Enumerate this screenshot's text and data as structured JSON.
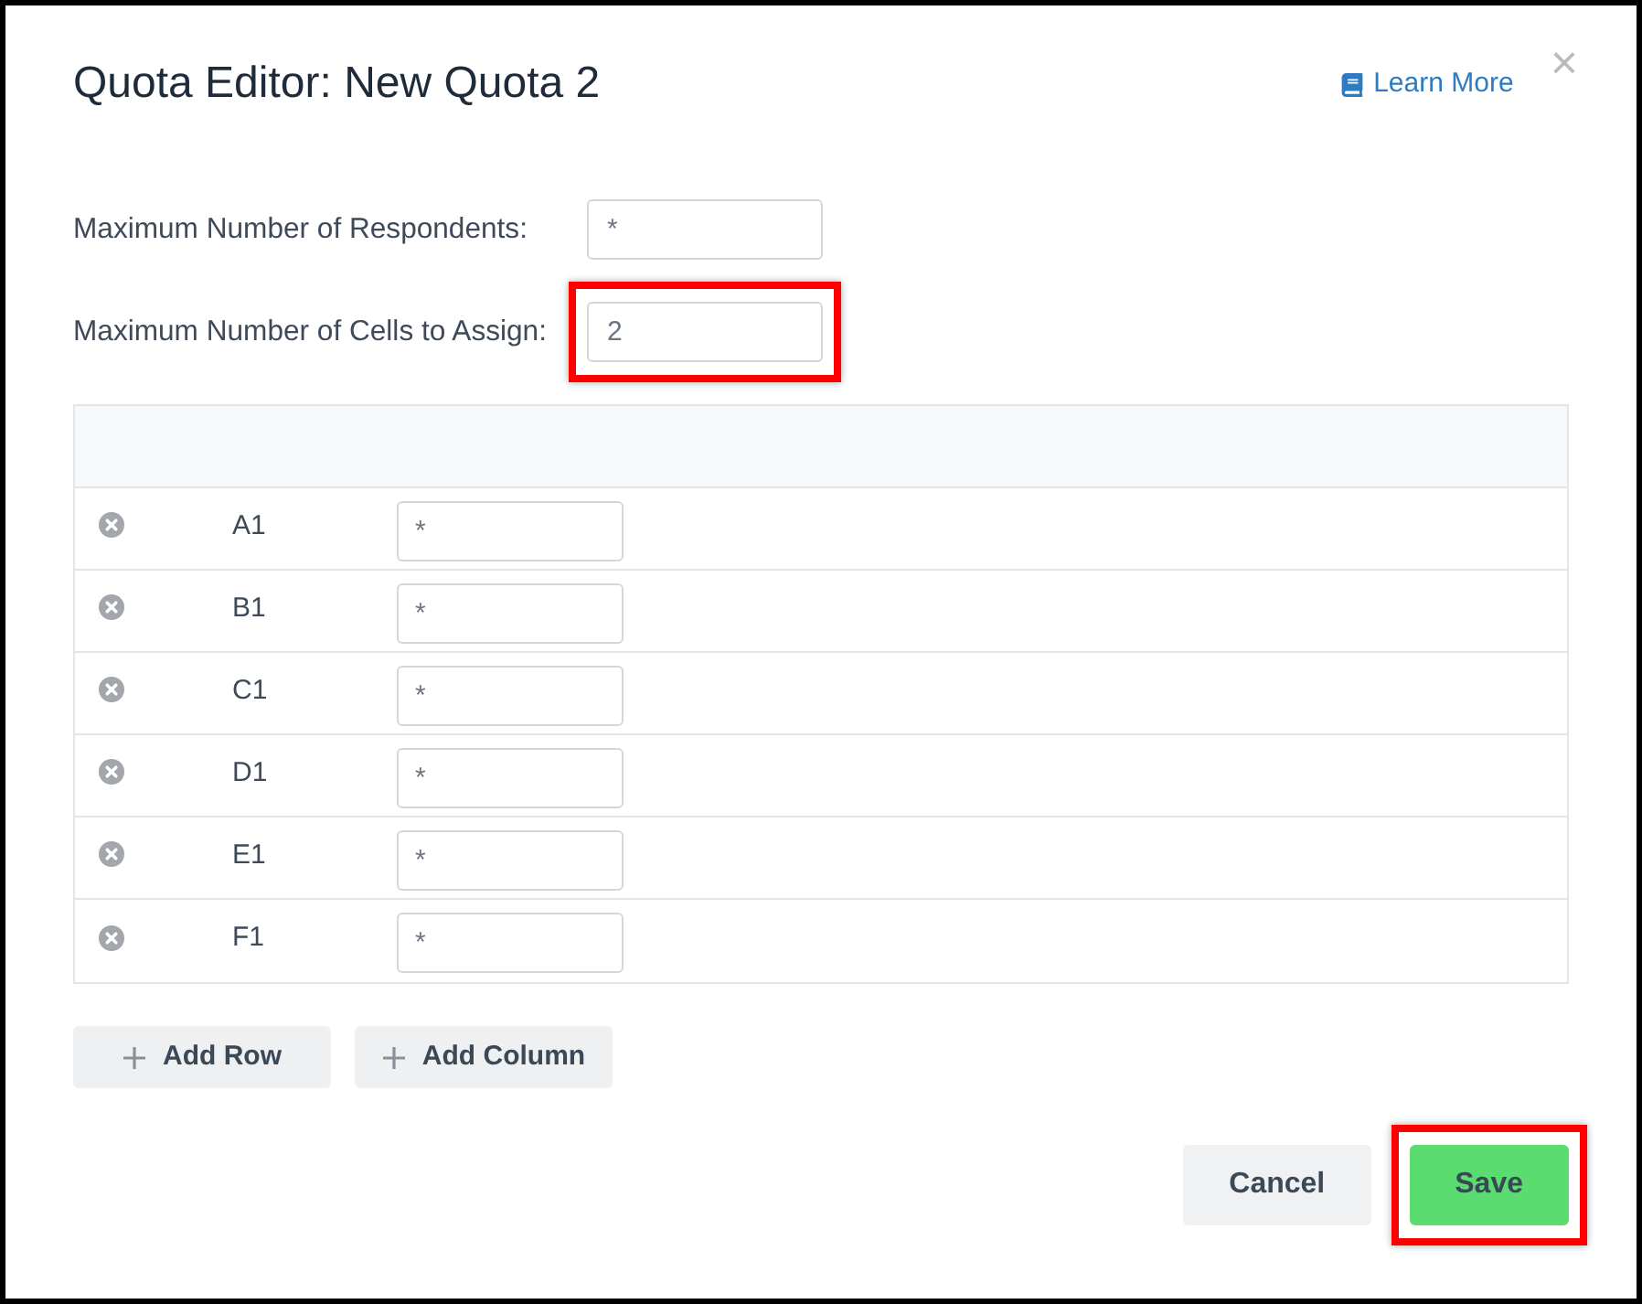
{
  "dialog": {
    "title": "Quota Editor: New Quota 2",
    "help_link": "Learn More",
    "close": "×"
  },
  "fields": [
    {
      "label": "Maximum Number of Respondents:",
      "value": "*",
      "highlighted": false
    },
    {
      "label": "Maximum Number of Cells to Assign:",
      "value": "2",
      "highlighted": true
    }
  ],
  "table": {
    "rows": [
      {
        "label": "A1",
        "value": "*"
      },
      {
        "label": "B1",
        "value": "*"
      },
      {
        "label": "C1",
        "value": "*"
      },
      {
        "label": "D1",
        "value": "*"
      },
      {
        "label": "E1",
        "value": "*"
      },
      {
        "label": "F1",
        "value": "*"
      }
    ]
  },
  "table_actions": [
    {
      "label": "Add Row"
    },
    {
      "label": "Add Column"
    }
  ],
  "footer_buttons": [
    {
      "label": "Cancel",
      "kind": "secondary",
      "highlighted": false
    },
    {
      "label": "Save",
      "kind": "primary",
      "highlighted": true
    }
  ]
}
